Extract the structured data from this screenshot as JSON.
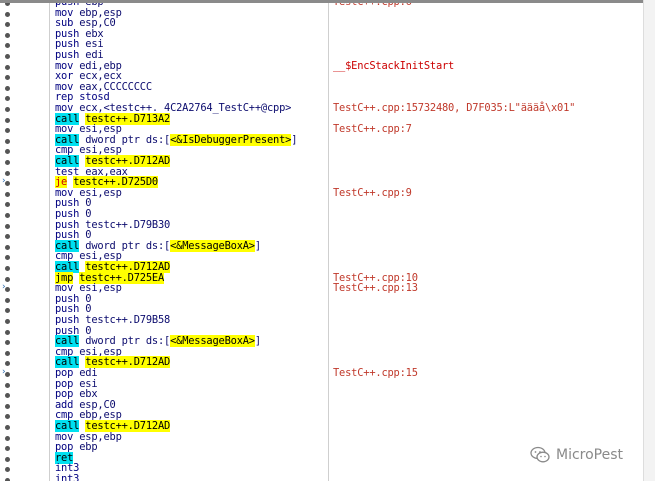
{
  "rows": [
    {
      "kind": "plain",
      "mn": "push",
      "op": "ebp",
      "comment": "TestC++.cpp:6"
    },
    {
      "kind": "plain",
      "mn": "mov",
      "op": "ebp,esp",
      "comment": ""
    },
    {
      "kind": "plain",
      "mn": "sub",
      "op": "esp,C0",
      "comment": ""
    },
    {
      "kind": "plain",
      "mn": "push",
      "op": "ebx",
      "comment": ""
    },
    {
      "kind": "plain",
      "mn": "push",
      "op": "esi",
      "comment": ""
    },
    {
      "kind": "plain",
      "mn": "push",
      "op": "edi",
      "comment": ""
    },
    {
      "kind": "plain",
      "mn": "mov",
      "op": "edi,ebp",
      "comment": "__$EncStackInitStart",
      "cm_label": true
    },
    {
      "kind": "plain",
      "mn": "xor",
      "op": "ecx,ecx",
      "comment": ""
    },
    {
      "kind": "plain",
      "mn": "mov",
      "op": "eax,CCCCCCCC",
      "comment": ""
    },
    {
      "kind": "plain",
      "mn": "rep stosd",
      "op": "",
      "comment": ""
    },
    {
      "kind": "plain",
      "mn": "mov",
      "op": "ecx,<testc++._4C2A2764_TestC++@cpp>",
      "comment": "TestC++.cpp:15732480, D7F035:L\"äääå\\x01\""
    },
    {
      "kind": "call",
      "mn": "call",
      "op": "testc++.D713A2",
      "comment": ""
    },
    {
      "kind": "plain",
      "mn": "mov",
      "op": "esi,esp",
      "comment": "TestC++.cpp:7"
    },
    {
      "kind": "callapi",
      "mn": "call",
      "pre": "dword ptr ds:[",
      "api": "<&IsDebuggerPresent>",
      "post": "]",
      "comment": ""
    },
    {
      "kind": "plain",
      "mn": "cmp",
      "op": "esi,esp",
      "comment": ""
    },
    {
      "kind": "call",
      "mn": "call",
      "op": "testc++.D712AD",
      "comment": ""
    },
    {
      "kind": "plain",
      "mn": "test",
      "op": "eax,eax",
      "comment": ""
    },
    {
      "kind": "je",
      "mn": "je",
      "op": "testc++.D725D0",
      "comment": "",
      "arrow": true
    },
    {
      "kind": "plain",
      "mn": "mov",
      "op": "esi,esp",
      "comment": "TestC++.cpp:9"
    },
    {
      "kind": "plain",
      "mn": "push",
      "op": "0",
      "comment": ""
    },
    {
      "kind": "plain",
      "mn": "push",
      "op": "0",
      "comment": ""
    },
    {
      "kind": "plain",
      "mn": "push",
      "op": "testc++.D79B30",
      "comment": ""
    },
    {
      "kind": "plain",
      "mn": "push",
      "op": "0",
      "comment": ""
    },
    {
      "kind": "callapi",
      "mn": "call",
      "pre": "dword ptr ds:[",
      "api": "<&MessageBoxA>",
      "post": "]",
      "comment": ""
    },
    {
      "kind": "plain",
      "mn": "cmp",
      "op": "esi,esp",
      "comment": ""
    },
    {
      "kind": "call",
      "mn": "call",
      "op": "testc++.D712AD",
      "comment": ""
    },
    {
      "kind": "jmp",
      "mn": "jmp",
      "op": "testc++.D725EA",
      "comment": "TestC++.cpp:10"
    },
    {
      "kind": "plain",
      "mn": "mov",
      "op": "esi,esp",
      "comment": "TestC++.cpp:13",
      "arrow": true
    },
    {
      "kind": "plain",
      "mn": "push",
      "op": "0",
      "comment": ""
    },
    {
      "kind": "plain",
      "mn": "push",
      "op": "0",
      "comment": ""
    },
    {
      "kind": "plain",
      "mn": "push",
      "op": "testc++.D79B58",
      "comment": ""
    },
    {
      "kind": "plain",
      "mn": "push",
      "op": "0",
      "comment": ""
    },
    {
      "kind": "callapi",
      "mn": "call",
      "pre": "dword ptr ds:[",
      "api": "<&MessageBoxA>",
      "post": "]",
      "comment": ""
    },
    {
      "kind": "plain",
      "mn": "cmp",
      "op": "esi,esp",
      "comment": ""
    },
    {
      "kind": "call",
      "mn": "call",
      "op": "testc++.D712AD",
      "comment": ""
    },
    {
      "kind": "plain",
      "mn": "pop",
      "op": "edi",
      "comment": "TestC++.cpp:15",
      "arrow": true
    },
    {
      "kind": "plain",
      "mn": "pop",
      "op": "esi",
      "comment": ""
    },
    {
      "kind": "plain",
      "mn": "pop",
      "op": "ebx",
      "comment": ""
    },
    {
      "kind": "plain",
      "mn": "add",
      "op": "esp,C0",
      "comment": ""
    },
    {
      "kind": "plain",
      "mn": "cmp",
      "op": "ebp,esp",
      "comment": ""
    },
    {
      "kind": "call",
      "mn": "call",
      "op": "testc++.D712AD",
      "comment": ""
    },
    {
      "kind": "plain",
      "mn": "mov",
      "op": "esp,ebp",
      "comment": ""
    },
    {
      "kind": "plain",
      "mn": "pop",
      "op": "ebp",
      "comment": ""
    },
    {
      "kind": "ret",
      "mn": "ret",
      "op": "",
      "comment": ""
    },
    {
      "kind": "plain",
      "mn": "int3",
      "op": "",
      "comment": ""
    },
    {
      "kind": "plain",
      "mn": "int3",
      "op": "",
      "comment": ""
    }
  ],
  "watermark": {
    "text": "MicroPest",
    "icon": "wechat-icon"
  },
  "colors": {
    "call_highlight": "#00e0f0",
    "jump_highlight": "#ffff00",
    "comment": "#c0392b",
    "mnemonic": "#000080"
  }
}
